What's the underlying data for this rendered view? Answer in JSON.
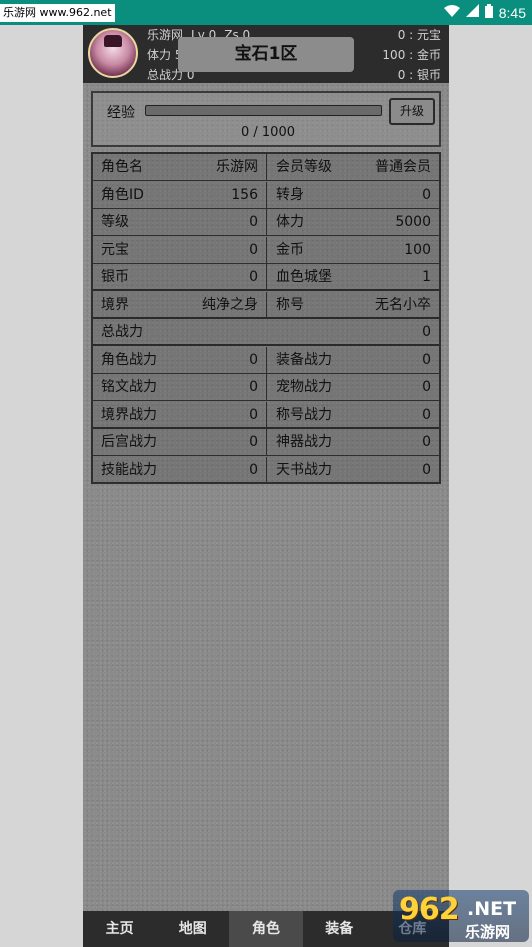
{
  "status_bar": {
    "watermark": "乐游网 www.962.net",
    "time": "8:45",
    "icons": [
      "wifi-icon",
      "signal-icon",
      "battery-icon"
    ]
  },
  "header": {
    "player_name": "乐游网",
    "level": "Lv 0",
    "zs": "Zs 0",
    "stamina": "体力 5000",
    "total_power": "总战力 0",
    "server": "宝石1区",
    "currency_yuanbao": "0 : 元宝",
    "currency_jinbi": "100 : 金币",
    "currency_yinbi": "0 : 银币"
  },
  "exp": {
    "label": "经验",
    "progress_fraction": 0,
    "text": "0 / 1000",
    "levelup_label": "升级"
  },
  "stats": [
    {
      "l_label": "角色名",
      "l_value": "乐游网",
      "r_label": "会员等级",
      "r_value": "普通会员"
    },
    {
      "l_label": "角色ID",
      "l_value": "156",
      "r_label": "转身",
      "r_value": "0"
    },
    {
      "l_label": "等级",
      "l_value": "0",
      "r_label": "体力",
      "r_value": "5000"
    },
    {
      "l_label": "元宝",
      "l_value": "0",
      "r_label": "金币",
      "r_value": "100"
    },
    {
      "l_label": "银币",
      "l_value": "0",
      "r_label": "血色城堡",
      "r_value": "1"
    },
    {
      "l_label": "境界",
      "l_value": "纯净之身",
      "r_label": "称号",
      "r_value": "无名小卒"
    },
    {
      "full_label": "总战力",
      "full_value": "0"
    },
    {
      "l_label": "角色战力",
      "l_value": "0",
      "r_label": "装备战力",
      "r_value": "0"
    },
    {
      "l_label": "铭文战力",
      "l_value": "0",
      "r_label": "宠物战力",
      "r_value": "0"
    },
    {
      "l_label": "境界战力",
      "l_value": "0",
      "r_label": "称号战力",
      "r_value": "0"
    },
    {
      "l_label": "后宫战力",
      "l_value": "0",
      "r_label": "神器战力",
      "r_value": "0"
    },
    {
      "l_label": "技能战力",
      "l_value": "0",
      "r_label": "天书战力",
      "r_value": "0"
    }
  ],
  "nav": {
    "items": [
      "主页",
      "地图",
      "角色",
      "装备",
      "仓库"
    ],
    "active": "角色"
  },
  "logo": {
    "num": "962",
    "net": ".NET",
    "cn": "乐游网"
  }
}
